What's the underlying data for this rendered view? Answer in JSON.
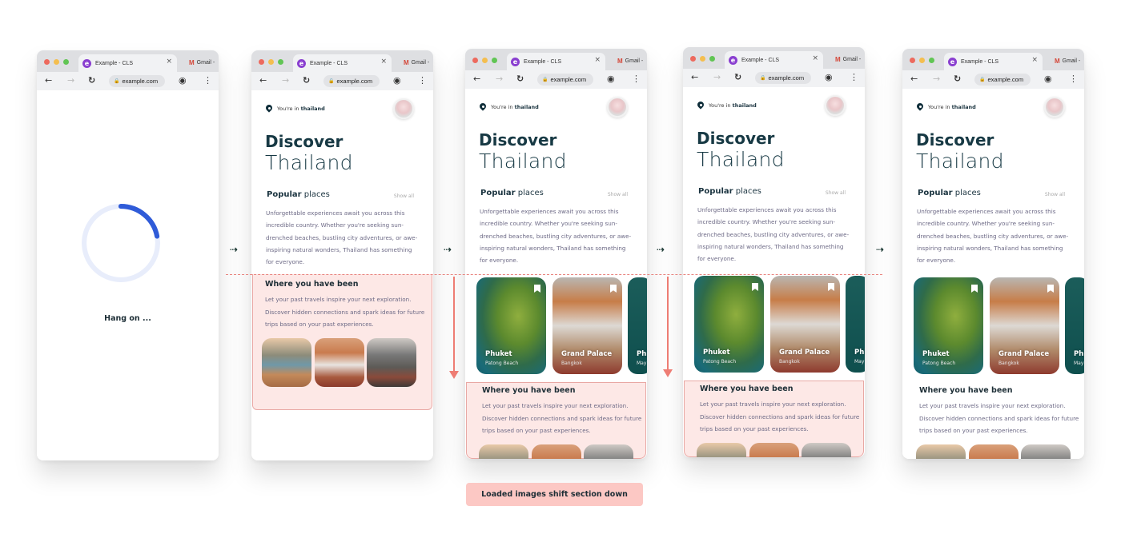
{
  "browser": {
    "tab_title": "Example - CLS",
    "tab_favicon_letter": "e",
    "second_tab_label": "Gmail -",
    "second_tab_icon": "gmail-icon",
    "url": "example.com",
    "window_dots": [
      "#ed6a5e",
      "#f4be4f",
      "#61c554"
    ],
    "icons": {
      "back": "←",
      "forward": "→",
      "reload": "↻",
      "lock": "🔒",
      "profile": "◉",
      "menu": "⋮",
      "close": "×",
      "gmail": "M"
    }
  },
  "loading": {
    "text": "Hang on ...",
    "progress_fraction": 0.22,
    "accent": "#2f5bd8",
    "track": "#e8edfb"
  },
  "app": {
    "location_prefix": "You're in",
    "location_name": "thailand",
    "title_bold": "Discover",
    "title_light": "Thailand",
    "popular_bold": "Popular",
    "popular_rest": "places",
    "show_all": "Show all",
    "description": "Unforgettable experiences await you across this incredible country. Whether you're seeking sun-drenched beaches, bustling city adventures, or awe-inspiring natural wonders, Thailand has something for everyone.",
    "where_title": "Where you have been",
    "where_description": "Let your past travels inspire your next exploration. Discover hidden connections and spark ideas for future trips based on your past experiences.",
    "cards": [
      {
        "title": "Phuket",
        "subtitle": "Patong Beach"
      },
      {
        "title": "Grand Palace",
        "subtitle": "Bangkok"
      },
      {
        "title": "Phi",
        "subtitle": "May"
      }
    ]
  },
  "annotations": {
    "arrow": "⇢",
    "caption": "Loaded images shift section down",
    "highlight_color": "#ee7d74"
  }
}
